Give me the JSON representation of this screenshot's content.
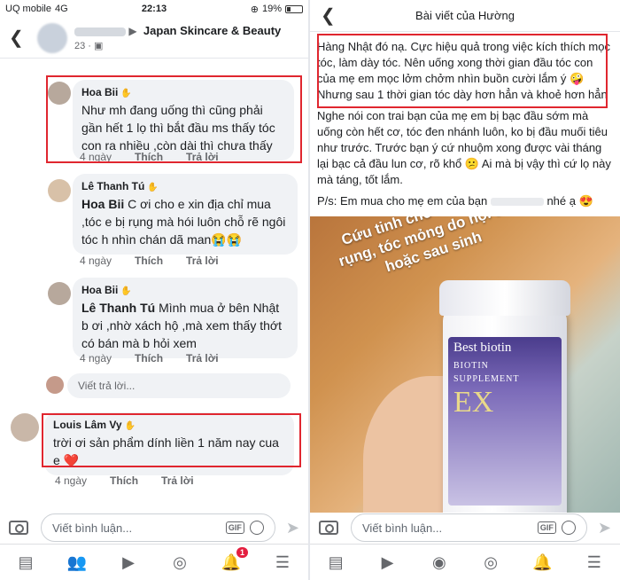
{
  "status": {
    "carrier": "UQ mobile",
    "network": "4G",
    "time": "22:13",
    "battery": "19%"
  },
  "left": {
    "header": {
      "group": "Japan Skincare & Beauty",
      "sub": "23 · "
    },
    "comments": [
      {
        "name": "Hoa Bii",
        "text": "Như mh đang uống thì cũng phải gần hết 1 lọ thì bắt đầu ms thấy tóc con ra nhiều ,còn dài thì chưa thấy",
        "time": "4 ngày",
        "like": "Thích",
        "reply": "Trả lời"
      },
      {
        "name": "Lê Thanh Tú",
        "mention": "Hoa Bii",
        "text": " C ơi cho e xin địa chỉ mua ,tóc e bị rụng mà hói luôn chỗ rẽ ngôi tóc h nhìn chán dã man😭😭",
        "time": "4 ngày",
        "like": "Thích",
        "reply": "Trả lời"
      },
      {
        "name": "Hoa Bii",
        "mention": "Lê Thanh Tú",
        "text": " Mình mua ở bên Nhật b ơi ,nhờ xách hộ ,mà xem thấy thớt có bán mà b hỏi xem",
        "time": "4 ngày",
        "like": "Thích",
        "reply": "Trả lời"
      },
      {
        "name": "Louis Lâm Vy",
        "text": "trời ơi sản phẩm dính liền 1 năm nay cua e ❤️",
        "time": "4 ngày",
        "like": "Thích",
        "reply": "Trả lời"
      }
    ],
    "reply_placeholder": "Viết trả lời...",
    "composer_placeholder": "Viết bình luận...",
    "gif_label": "GIF",
    "notification_count": "1"
  },
  "right": {
    "header_title": "Bài viết của Hường",
    "paragraphs": [
      "Hàng Nhật đó nạ. Cực hiệu quả trong việc kích thích mọc tóc, làm dày tóc. Nên uống xong thời gian đầu tóc con của mẹ em mọc lởm chởm nhìn buồn cười lắm ý 🤪 Nhưng sau 1 thời gian tóc dày hơn hẳn và khoẻ hơn hẳn",
      "Nghe nói con trai bạn của mẹ em bị bạc đầu sớm mà uống còn hết cơ, tóc đen nhánh luôn, ko bị đầu muối tiêu như trước. Trước bạn ý cứ nhuộm xong được vài tháng lại bạc cả đầu lun cơ, rõ khổ 😕 Ai mà bị vậy thì cứ lọ này mà táng, tốt lắm."
    ],
    "ps_prefix": "P/s: Em mua cho mẹ em của bạn",
    "ps_suffix": " nhé ạ 😍",
    "photo_caption": "Cứu tinh cho ai tóc hay rụng, tóc mỏng do nội tiết hoặc sau sinh",
    "bottle": {
      "brand": "Best biotin",
      "line1": "BIOTIN",
      "line2": "SUPPLEMENT",
      "ex": "EX"
    },
    "composer_placeholder": "Viết bình luận...",
    "gif_label": "GIF"
  }
}
